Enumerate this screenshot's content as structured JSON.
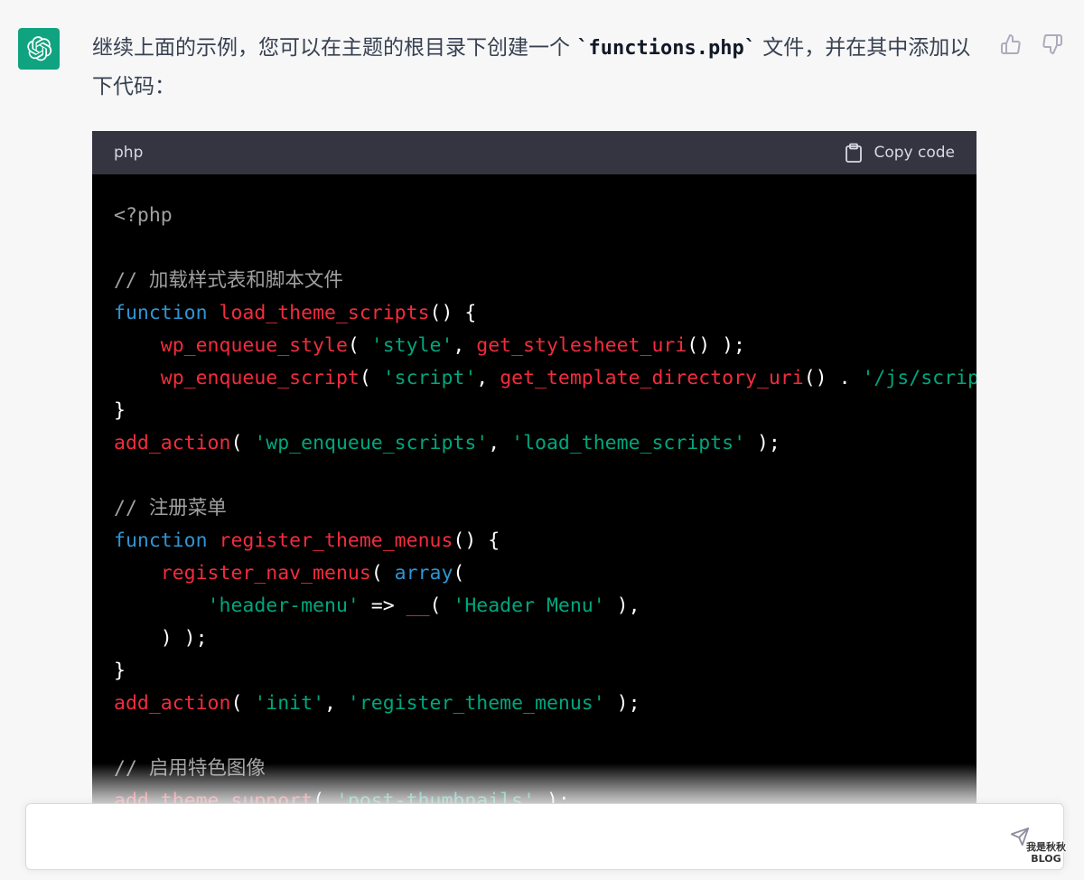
{
  "message": {
    "text_before": "继续上面的示例，您可以在主题的根目录下创建一个 ",
    "code_inline": "`functions.php`",
    "text_after": " 文件，并在其中添加以下代码："
  },
  "feedback": {
    "thumbs_up_icon": "thumbs-up-icon",
    "thumbs_down_icon": "thumbs-down-icon"
  },
  "code_block": {
    "language": "php",
    "copy_label": "Copy code",
    "lines": [
      [
        {
          "t": "<?php",
          "c": "cm"
        }
      ],
      [],
      [
        {
          "t": "// 加载样式表和脚本文件",
          "c": "cm"
        }
      ],
      [
        {
          "t": "function",
          "c": "kw"
        },
        {
          "t": " ",
          "c": "p"
        },
        {
          "t": "load_theme_scripts",
          "c": "fn"
        },
        {
          "t": "() {",
          "c": "p"
        }
      ],
      [
        {
          "t": "    ",
          "c": "p"
        },
        {
          "t": "wp_enqueue_style",
          "c": "fn"
        },
        {
          "t": "( ",
          "c": "p"
        },
        {
          "t": "'style'",
          "c": "str"
        },
        {
          "t": ", ",
          "c": "p"
        },
        {
          "t": "get_stylesheet_uri",
          "c": "fn"
        },
        {
          "t": "() );",
          "c": "p"
        }
      ],
      [
        {
          "t": "    ",
          "c": "p"
        },
        {
          "t": "wp_enqueue_script",
          "c": "fn"
        },
        {
          "t": "( ",
          "c": "p"
        },
        {
          "t": "'script'",
          "c": "str"
        },
        {
          "t": ", ",
          "c": "p"
        },
        {
          "t": "get_template_directory_uri",
          "c": "fn"
        },
        {
          "t": "() . ",
          "c": "p"
        },
        {
          "t": "'/js/script.",
          "c": "str"
        }
      ],
      [
        {
          "t": "}",
          "c": "p"
        }
      ],
      [
        {
          "t": "add_action",
          "c": "fn"
        },
        {
          "t": "( ",
          "c": "p"
        },
        {
          "t": "'wp_enqueue_scripts'",
          "c": "str"
        },
        {
          "t": ", ",
          "c": "p"
        },
        {
          "t": "'load_theme_scripts'",
          "c": "str"
        },
        {
          "t": " );",
          "c": "p"
        }
      ],
      [],
      [
        {
          "t": "// 注册菜单",
          "c": "cm"
        }
      ],
      [
        {
          "t": "function",
          "c": "kw"
        },
        {
          "t": " ",
          "c": "p"
        },
        {
          "t": "register_theme_menus",
          "c": "fn"
        },
        {
          "t": "() {",
          "c": "p"
        }
      ],
      [
        {
          "t": "    ",
          "c": "p"
        },
        {
          "t": "register_nav_menus",
          "c": "fn"
        },
        {
          "t": "( ",
          "c": "p"
        },
        {
          "t": "array",
          "c": "kw"
        },
        {
          "t": "(",
          "c": "p"
        }
      ],
      [
        {
          "t": "        ",
          "c": "p"
        },
        {
          "t": "'header-menu'",
          "c": "str"
        },
        {
          "t": " => ",
          "c": "p"
        },
        {
          "t": "__",
          "c": "fn"
        },
        {
          "t": "( ",
          "c": "p"
        },
        {
          "t": "'Header Menu'",
          "c": "str"
        },
        {
          "t": " ),",
          "c": "p"
        }
      ],
      [
        {
          "t": "    ) );",
          "c": "p"
        }
      ],
      [
        {
          "t": "}",
          "c": "p"
        }
      ],
      [
        {
          "t": "add_action",
          "c": "fn"
        },
        {
          "t": "( ",
          "c": "p"
        },
        {
          "t": "'init'",
          "c": "str"
        },
        {
          "t": ", ",
          "c": "p"
        },
        {
          "t": "'register_theme_menus'",
          "c": "str"
        },
        {
          "t": " );",
          "c": "p"
        }
      ],
      [],
      [
        {
          "t": "// 启用特色图像",
          "c": "cm"
        }
      ],
      [
        {
          "t": "add_theme_support",
          "c": "fn"
        },
        {
          "t": "( ",
          "c": "p"
        },
        {
          "t": "'post-thumbnails'",
          "c": "str"
        },
        {
          "t": " );",
          "c": "p"
        }
      ]
    ]
  },
  "input": {
    "placeholder": "",
    "send_icon": "send-icon"
  },
  "watermark": {
    "line1": "我是秋秋",
    "line2": "BLOG"
  },
  "colors": {
    "accent": "#10a37f",
    "keyword": "#2e95d3",
    "function": "#f22c3d",
    "string": "#00a67d",
    "comment": "#a0a0a0"
  }
}
